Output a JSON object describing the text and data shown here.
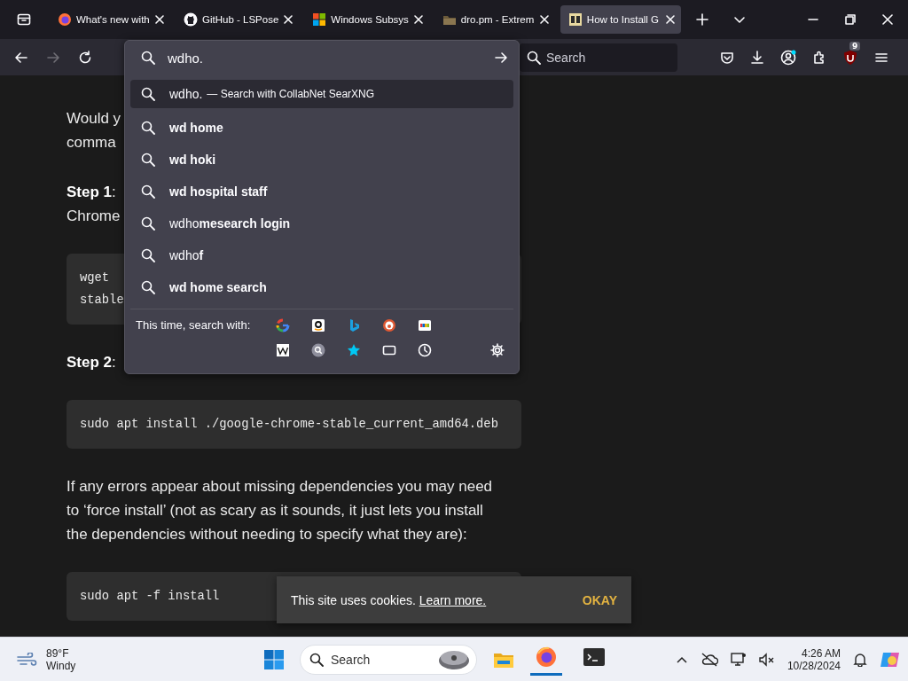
{
  "tabs": [
    {
      "kind": "firefox",
      "title": "What's new with",
      "selected": false
    },
    {
      "kind": "github",
      "title": "GitHub - LSPose",
      "selected": false
    },
    {
      "kind": "windows",
      "title": "Windows Subsys",
      "selected": false
    },
    {
      "kind": "folder",
      "title": "dro.pm - Extrem",
      "selected": false
    },
    {
      "kind": "site",
      "title": "How to Install G",
      "selected": true
    }
  ],
  "toolbar": {
    "search": {
      "placeholder": "Search"
    },
    "badge": "9"
  },
  "urlbar": {
    "value": "wdho."
  },
  "suggestions": [
    {
      "text": "wdho.",
      "action": "— Search with CollabNet SearXNG",
      "selected": true
    },
    {
      "text": "**wd home**",
      "selected": false
    },
    {
      "text": "**wd hoki**",
      "selected": false
    },
    {
      "text": "**wd hospital staff**",
      "selected": false
    },
    {
      "text": "wdho**mesearch login**",
      "selected": false
    },
    {
      "text": "wdho**f**",
      "selected": false
    },
    {
      "text": "**wd home search**",
      "selected": false
    }
  ],
  "search_with": {
    "label": "This time, search with:"
  },
  "article": [
    {
      "kind": "text",
      "lines": [
        "Would y",
        "comma"
      ]
    },
    {
      "kind": "text",
      "lines": [
        "**Step 1**:",
        "Chrome"
      ]
    },
    {
      "kind": "code",
      "lines": [
        "wget",
        "stable"
      ]
    },
    {
      "kind": "text",
      "lines": [
        "**Step 2**:"
      ]
    },
    {
      "kind": "code",
      "lines": [
        "sudo apt install ./google-chrome-stable_current_amd64.deb"
      ]
    },
    {
      "kind": "text",
      "lines": [
        "If any errors appear about missing dependencies you may need",
        "to ‘force install’ (not as scary as it sounds, it just lets you install",
        "the dependencies without needing to specify what they are):"
      ]
    },
    {
      "kind": "code",
      "lines": [
        "sudo apt -f install"
      ]
    }
  ],
  "cookie_banner": {
    "text": "This site uses cookies.",
    "link": "Learn more.",
    "button": "OKAY"
  },
  "taskbar": {
    "weather": {
      "temperature": "89°F",
      "condition": "Windy"
    },
    "search": {
      "placeholder": "Search"
    },
    "time": "4:26 AM",
    "date": "10/28/2024"
  }
}
